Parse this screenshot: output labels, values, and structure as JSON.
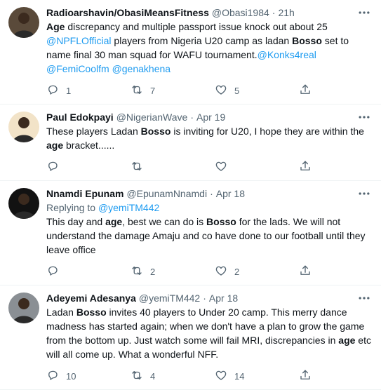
{
  "tweets": [
    {
      "name": "Radioarshavin/ObasiMeansFitness",
      "handle": "@Obasi1984",
      "time": "21h",
      "reply_to": null,
      "segments": [
        {
          "b": "Age"
        },
        {
          "t": " discrepancy and multiple passport issue knock out about 25 "
        },
        {
          "m": "@NPFLOfficial"
        },
        {
          "t": "  players from Nigeria U20 camp as ladan "
        },
        {
          "b": "Bosso"
        },
        {
          "t": " set to name final 30 man squad for WAFU tournament."
        },
        {
          "m": "@Konks4real"
        },
        {
          "t": " "
        },
        {
          "m": "@FemiCoolfm"
        },
        {
          "t": " "
        },
        {
          "m": "@genakhena"
        }
      ],
      "replies": "1",
      "retweets": "7",
      "likes": "5",
      "avatar_bg": "#5a4a3a"
    },
    {
      "name": "Paul Edokpayi",
      "handle": "@NigerianWave",
      "time": "Apr 19",
      "reply_to": null,
      "segments": [
        {
          "t": "These players Ladan "
        },
        {
          "b": "Bosso"
        },
        {
          "t": " is inviting for U20, I hope they are within the "
        },
        {
          "b": "age"
        },
        {
          "t": " bracket......"
        }
      ],
      "replies": "",
      "retweets": "",
      "likes": "",
      "avatar_bg": "#f2e3c8"
    },
    {
      "name": "Nnamdi Epunam",
      "handle": "@EpunamNnamdi",
      "time": "Apr 18",
      "reply_to": {
        "prefix": "Replying to ",
        "handle": "@yemiTM442"
      },
      "segments": [
        {
          "t": "This day and "
        },
        {
          "b": "age"
        },
        {
          "t": ", best we can do is "
        },
        {
          "b": "Bosso"
        },
        {
          "t": " for the lads. We will not understand the damage Amaju and co have done to our football until they leave office"
        }
      ],
      "replies": "",
      "retweets": "2",
      "likes": "2",
      "avatar_bg": "#121212"
    },
    {
      "name": "Adeyemi Adesanya",
      "handle": "@yemiTM442",
      "time": "Apr 18",
      "reply_to": null,
      "segments": [
        {
          "t": "Ladan "
        },
        {
          "b": "Bosso"
        },
        {
          "t": " invites 40 players to Under 20 camp. This merry dance madness has started again; when we don't have a plan to grow the game from the bottom up. Just watch some will fail MRI, discrepancies in "
        },
        {
          "b": "age"
        },
        {
          "t": " etc will all come up. What a wonderful NFF."
        }
      ],
      "replies": "10",
      "retweets": "4",
      "likes": "14",
      "avatar_bg": "#8a8f94"
    }
  ],
  "dot": "·",
  "icons": {
    "reply": "reply-icon",
    "retweet": "retweet-icon",
    "like": "heart-icon",
    "share": "share-icon",
    "more": "more-icon"
  }
}
